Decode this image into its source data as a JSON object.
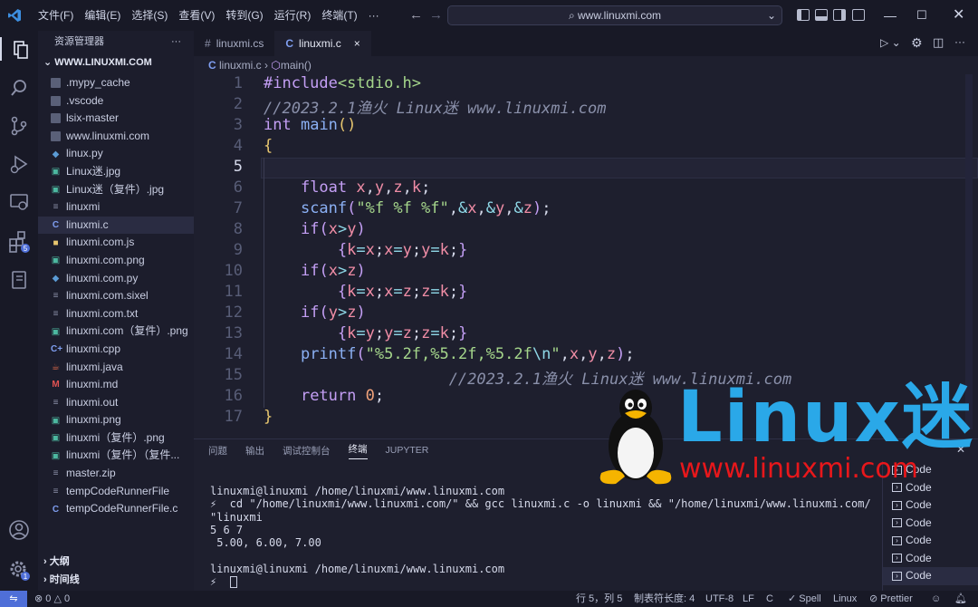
{
  "menu": [
    "文件(F)",
    "编辑(E)",
    "选择(S)",
    "查看(V)",
    "转到(G)",
    "运行(R)",
    "终端(T)",
    "···"
  ],
  "command_center": "www.linuxmi.com",
  "sidebar": {
    "title": "资源管理器",
    "more": "···",
    "root": "WWW.LINUXMI.COM",
    "items": [
      {
        "label": ".mypy_cache",
        "icon": "folder-icon"
      },
      {
        "label": ".vscode",
        "icon": "folder-icon"
      },
      {
        "label": "lsix-master",
        "icon": "folder-icon"
      },
      {
        "label": "www.linuxmi.com",
        "icon": "folder-icon"
      },
      {
        "label": "linux.py",
        "icon": "python-file-icon"
      },
      {
        "label": "Linux迷.jpg",
        "icon": "image-file-icon"
      },
      {
        "label": "Linux迷（复件）.jpg",
        "icon": "image-file-icon"
      },
      {
        "label": "linuxmi",
        "icon": "file-icon"
      },
      {
        "label": "linuxmi.c",
        "icon": "c-file-icon"
      },
      {
        "label": "linuxmi.com.js",
        "icon": "js-file-icon"
      },
      {
        "label": "linuxmi.com.png",
        "icon": "image-file-icon"
      },
      {
        "label": "linuxmi.com.py",
        "icon": "python-file-icon"
      },
      {
        "label": "linuxmi.com.sixel",
        "icon": "file-icon"
      },
      {
        "label": "linuxmi.com.txt",
        "icon": "file-icon"
      },
      {
        "label": "linuxmi.com（复件）.png",
        "icon": "image-file-icon"
      },
      {
        "label": "linuxmi.cpp",
        "icon": "cpp-file-icon"
      },
      {
        "label": "linuxmi.java",
        "icon": "java-file-icon"
      },
      {
        "label": "linuxmi.md",
        "icon": "markdown-file-icon"
      },
      {
        "label": "linuxmi.out",
        "icon": "file-icon"
      },
      {
        "label": "linuxmi.png",
        "icon": "image-file-icon"
      },
      {
        "label": "linuxmi（复件）.png",
        "icon": "image-file-icon"
      },
      {
        "label": "linuxmi（复件）（复件...",
        "icon": "image-file-icon"
      },
      {
        "label": "master.zip",
        "icon": "file-icon"
      },
      {
        "label": "tempCodeRunnerFile",
        "icon": "file-icon"
      },
      {
        "label": "tempCodeRunnerFile.c",
        "icon": "c-file-icon"
      }
    ],
    "outline": "大纲",
    "timeline": "时间线"
  },
  "tabs": [
    {
      "label": "linuxmi.cs",
      "icon": "#"
    },
    {
      "label": "linuxmi.c",
      "icon": "C",
      "close": "×"
    }
  ],
  "breadcrumb": {
    "file": "linuxmi.c",
    "sep": "›",
    "symbol": "main()"
  },
  "editor": {
    "line_numbers": [
      "1",
      "2",
      "3",
      "4",
      "5",
      "6",
      "7",
      "8",
      "9",
      "10",
      "11",
      "12",
      "13",
      "14",
      "15",
      "16",
      "17"
    ],
    "current_line": 5
  },
  "panel": {
    "tabs": [
      "问题",
      "输出",
      "调试控制台",
      "终端",
      "JUPYTER"
    ],
    "active": "终端",
    "terminal_lines": [
      "linuxmi@linuxmi /home/linuxmi/www.linuxmi.com",
      "⚡  cd \"/home/linuxmi/www.linuxmi.com/\" && gcc linuxmi.c -o linuxmi && \"/home/linuxmi/www.linuxmi.com/",
      "\"linuxmi",
      "5 6 7",
      " 5.00, 6.00, 7.00",
      "",
      "linuxmi@linuxmi /home/linuxmi/www.linuxmi.com",
      "⚡ "
    ],
    "terminal_list": [
      "Code",
      "Code",
      "Code",
      "Code",
      "Code",
      "Code",
      "Code"
    ]
  },
  "watermark": {
    "title": "Linux迷",
    "url": "www.linuxmi.com"
  },
  "status": {
    "problems": "⊗ 0 △ 0",
    "position": "行 5，列 5",
    "tab_size": "制表符长度: 4",
    "encoding": "UTF-8",
    "eol": "LF",
    "language": "C",
    "spell": "✓ Spell",
    "os": "Linux",
    "prettier": "⊘ Prettier"
  },
  "colors": {
    "accent": "#4f6fd8",
    "watermark_blue": "#2aa8e8",
    "watermark_red": "#e8171b"
  }
}
